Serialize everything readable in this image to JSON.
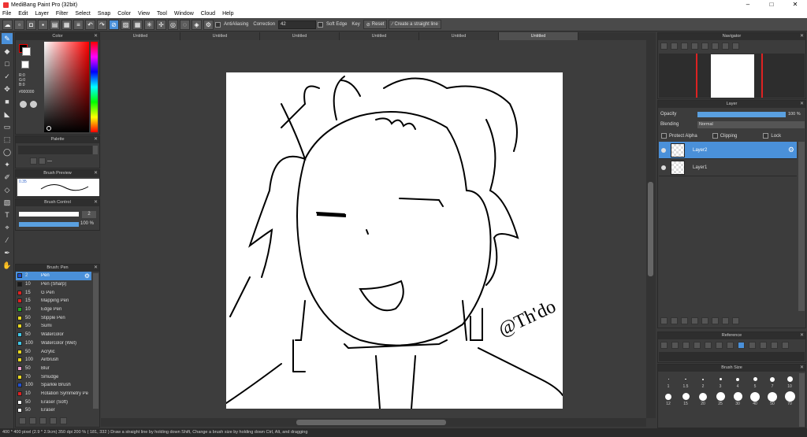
{
  "window": {
    "title": "MediBang Paint Pro (32bit)",
    "min": "–",
    "max": "□",
    "close": "✕"
  },
  "menu": [
    "File",
    "Edit",
    "Layer",
    "Filter",
    "Select",
    "Snap",
    "Color",
    "View",
    "Tool",
    "Window",
    "Cloud",
    "Help"
  ],
  "toolbar": {
    "antialias": "AntiAliasing",
    "correction_label": "Correction",
    "correction_value": "42",
    "soft_edge": "Soft Edge",
    "key": "Key",
    "reset": "Reset",
    "straight_line": "Create a straight line"
  },
  "tabs": [
    "Untitled",
    "Untitled",
    "Untitled",
    "Untitled",
    "Untitled",
    "Untitled"
  ],
  "color_panel": {
    "title": "Color",
    "r": "R:0",
    "g": "G:0",
    "b": "B:0",
    "hex": "#000000"
  },
  "palette_panel": {
    "title": "Palette",
    "dash": "—"
  },
  "brush_preview": {
    "title": "Brush Preview",
    "size": "0.35"
  },
  "brush_control": {
    "title": "Brush Control",
    "size_value": "2",
    "opacity": "100 %"
  },
  "brush_panel": {
    "title": "Brush: Pen",
    "items": [
      {
        "size": "2",
        "name": "Pen",
        "color": "#1a4fd8"
      },
      {
        "size": "10",
        "name": "Pen (Sharp)",
        "color": "#1a1a1a"
      },
      {
        "size": "15",
        "name": "G Pen",
        "color": "#e02020"
      },
      {
        "size": "15",
        "name": "Mapping Pen",
        "color": "#e02020"
      },
      {
        "size": "10",
        "name": "Edge Pen",
        "color": "#20b020"
      },
      {
        "size": "50",
        "name": "Stipple Pen",
        "color": "#e8d820"
      },
      {
        "size": "50",
        "name": "Sumi",
        "color": "#e8d820"
      },
      {
        "size": "50",
        "name": "Watercolor",
        "color": "#40c8e8"
      },
      {
        "size": "100",
        "name": "Watercolor (Wet)",
        "color": "#40c8e8"
      },
      {
        "size": "50",
        "name": "Acrylic",
        "color": "#e8d820"
      },
      {
        "size": "100",
        "name": "Airbrush",
        "color": "#e8d820"
      },
      {
        "size": "50",
        "name": "Blur",
        "color": "#f0a0d0"
      },
      {
        "size": "70",
        "name": "Smudge",
        "color": "#e8d820"
      },
      {
        "size": "100",
        "name": "Sparkle Brush",
        "color": "#2050d0"
      },
      {
        "size": "10",
        "name": "Rotation Symmetry Pe",
        "color": "#e02020"
      },
      {
        "size": "50",
        "name": "Eraser (Soft)",
        "color": "#ffffff"
      },
      {
        "size": "50",
        "name": "Eraser",
        "color": "#ffffff"
      }
    ]
  },
  "navigator": {
    "title": "Navigator"
  },
  "layer_panel": {
    "title": "Layer",
    "opacity_label": "Opacity",
    "opacity_value": "100 %",
    "blending_label": "Blending",
    "blending_value": "Normal",
    "protect_alpha": "Protect Alpha",
    "clipping": "Clipping",
    "lock": "Lock",
    "layers": [
      "Layer2",
      "Layer1"
    ]
  },
  "reference_panel": {
    "title": "Reference"
  },
  "brush_size_panel": {
    "title": "Brush Size",
    "row1": [
      "1",
      "1.5",
      "2",
      "3",
      "4",
      "5",
      "7",
      "10"
    ],
    "row2": [
      "12",
      "15",
      "20",
      "25",
      "30",
      "40",
      "50",
      "70"
    ]
  },
  "signature": "@Th'do",
  "status": "400 * 400 pixel  (2.9 * 2.9cm)  350 dpi  200 %  ( 181, 332 )  Draw a straight line by holding down Shift, Change a brush size by holding down Ctrl, Alt, and dragging"
}
